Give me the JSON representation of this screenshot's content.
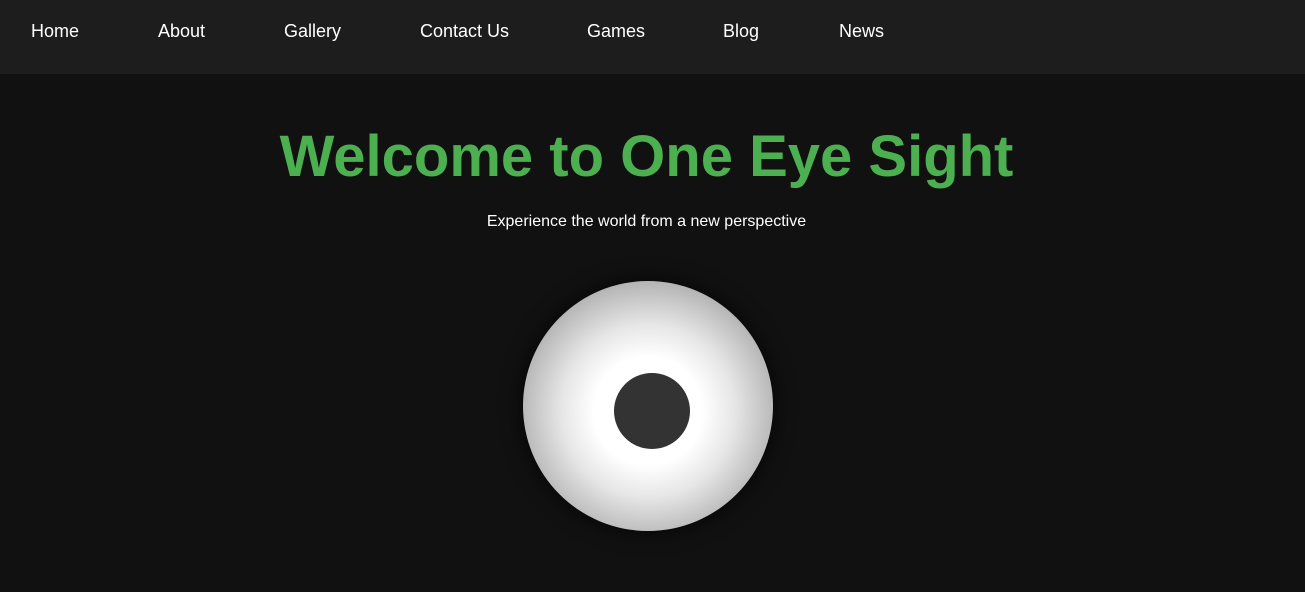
{
  "nav": {
    "items": [
      {
        "label": "Home"
      },
      {
        "label": "About"
      },
      {
        "label": "Gallery"
      },
      {
        "label": "Contact Us"
      },
      {
        "label": "Games"
      },
      {
        "label": "Blog"
      },
      {
        "label": "News"
      }
    ]
  },
  "hero": {
    "title": "Welcome to One Eye Sight",
    "subtitle": "Experience the world from a new perspective"
  },
  "colors": {
    "background": "#111111",
    "navbar": "#1d1d1d",
    "accent": "#4caf50",
    "pupil": "#333333"
  }
}
